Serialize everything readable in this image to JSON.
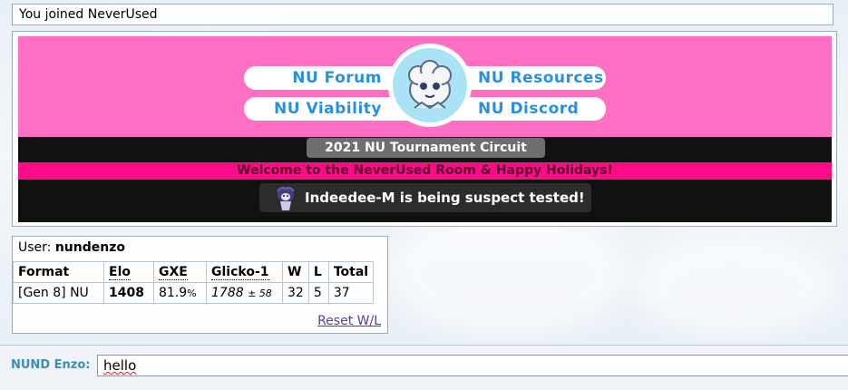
{
  "notice": {
    "text": "You joined NeverUsed"
  },
  "banner": {
    "links": {
      "forum": "NU Forum",
      "resources": "NU Resources",
      "viability": "NU Viability",
      "discord": "NU Discord"
    },
    "circuit": "2021 NU Tournament Circuit",
    "welcome": "Welcome to the NeverUsed Room & Happy Holidays!",
    "suspect": "Indeedee-M is being suspect tested!",
    "colors": {
      "pink": "#ff6fc4",
      "magenta": "#ff0a87",
      "link_blue": "#2b8fe0"
    }
  },
  "stats": {
    "user_label": "User:",
    "user_name": "nundenzo",
    "headers": [
      "Format",
      "Elo",
      "GXE",
      "Glicko-1",
      "W",
      "L",
      "Total"
    ],
    "row": {
      "format": "[Gen 8] NU",
      "elo": "1408",
      "gxe": "81.9",
      "gxe_unit": "%",
      "glicko": "1788",
      "glicko_dev": "± 58",
      "w": "32",
      "l": "5",
      "total": "37"
    },
    "reset_label": "Reset W/L"
  },
  "chat": {
    "name": "NUND Enzo:",
    "input_value": "hello"
  }
}
